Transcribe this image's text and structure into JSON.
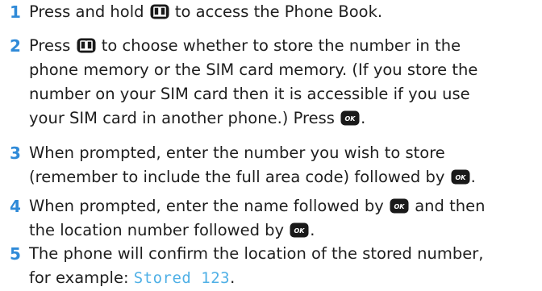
{
  "steps": [
    {
      "number": "1",
      "lines": [
        {
          "a": "Press and hold ",
          "b": " to access the Phone Book."
        }
      ]
    },
    {
      "number": "2",
      "lines": [
        {
          "a": "Press ",
          "b": " to choose whether to store the number in the"
        },
        {
          "a": "phone memory or the SIM card memory. (If you store the"
        },
        {
          "a": "number on your SIM card then it is accessible if you use"
        },
        {
          "a": "your SIM card in another phone.) Press ",
          "b": "."
        }
      ]
    },
    {
      "number": "3",
      "lines": [
        {
          "a": "When prompted, enter the number you wish to store"
        },
        {
          "a": "(remember to include the full area code) followed by ",
          "b": "."
        }
      ]
    },
    {
      "number": "4",
      "lines": [
        {
          "a": "When prompted, enter the name followed by ",
          "b": " and then"
        },
        {
          "a": "the location number followed by ",
          "b": "."
        }
      ]
    },
    {
      "number": "5",
      "lines": [
        {
          "a": "The phone will confirm the location of the stored number,"
        },
        {
          "a": "for example: ",
          "display": "Stored 123",
          "b": "."
        }
      ]
    }
  ],
  "keys": {
    "ok_label": "OK"
  }
}
